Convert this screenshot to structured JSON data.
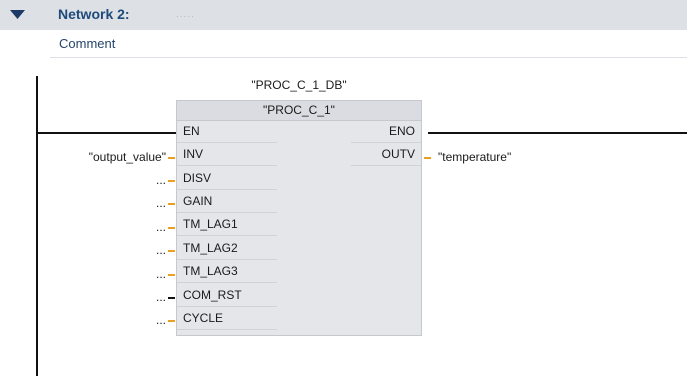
{
  "network": {
    "title": "Network 2:",
    "name": ".....",
    "comment": "Comment"
  },
  "block": {
    "instance_db": "\"PROC_C_1_DB\"",
    "type_name": "\"PROC_C_1\"",
    "en_label": "EN",
    "eno_label": "ENO",
    "inputs": [
      {
        "pin": "INV",
        "operand": "\"output_value\""
      },
      {
        "pin": "DISV",
        "operand": "..."
      },
      {
        "pin": "GAIN",
        "operand": "..."
      },
      {
        "pin": "TM_LAG1",
        "operand": "..."
      },
      {
        "pin": "TM_LAG2",
        "operand": "..."
      },
      {
        "pin": "TM_LAG3",
        "operand": "..."
      },
      {
        "pin": "COM_RST",
        "operand": "..."
      },
      {
        "pin": "CYCLE",
        "operand": "..."
      }
    ],
    "outputs": [
      {
        "pin": "OUTV",
        "operand": "\"temperature\""
      }
    ]
  },
  "colors": {
    "header_bg": "#dde1e6",
    "title": "#1e4a7a",
    "block_bg": "#e5e6ea",
    "input_tick": "#e8a020"
  }
}
